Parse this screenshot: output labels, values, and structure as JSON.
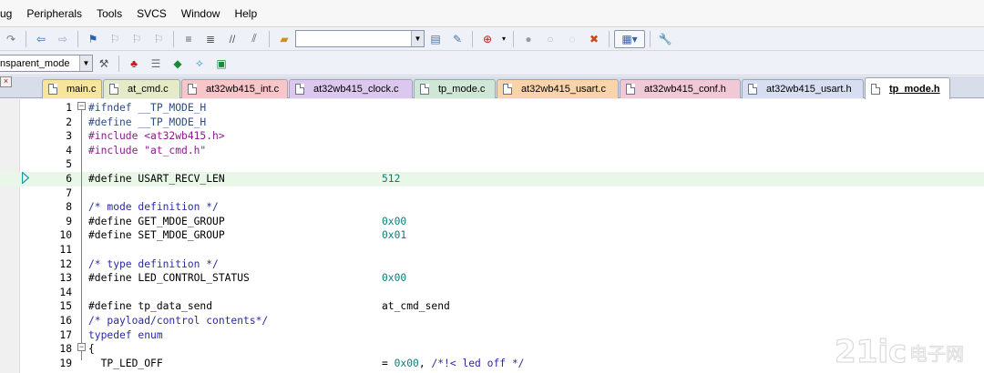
{
  "menu": [
    "ug",
    "Peripherals",
    "Tools",
    "SVCS",
    "Window",
    "Help"
  ],
  "toolbar": {
    "search_value": "",
    "mode_value": "nsparent_mode"
  },
  "tabs": [
    {
      "label": "main.c",
      "color": "#f7e59c",
      "active": false
    },
    {
      "label": "at_cmd.c",
      "color": "#e6ebc7",
      "active": false
    },
    {
      "label": "at32wb415_int.c",
      "color": "#f7c6c9",
      "active": false
    },
    {
      "label": "at32wb415_clock.c",
      "color": "#dcc8ef",
      "active": false
    },
    {
      "label": "tp_mode.c",
      "color": "#cfe7d6",
      "active": false
    },
    {
      "label": "at32wb415_usart.c",
      "color": "#f9d4aa",
      "active": false
    },
    {
      "label": "at32wb415_conf.h",
      "color": "#f1c8d6",
      "active": false
    },
    {
      "label": "at32wb415_usart.h",
      "color": "#d7def1",
      "active": false
    },
    {
      "label": "tp_mode.h",
      "color": "#ffffff",
      "active": true
    }
  ],
  "code": [
    {
      "n": "1",
      "code": [
        {
          "t": "#ifndef __TP_MODE_H",
          "c": "pp"
        }
      ]
    },
    {
      "n": "2",
      "code": [
        {
          "t": "#define __TP_MODE_H",
          "c": "pp"
        }
      ]
    },
    {
      "n": "3",
      "code": [
        {
          "t": "#include ",
          "c": "str"
        },
        {
          "t": "<at32wb415.h>",
          "c": "str"
        }
      ]
    },
    {
      "n": "4",
      "code": [
        {
          "t": "#include ",
          "c": "str"
        },
        {
          "t": "\"at_cmd.h\"",
          "c": "str"
        }
      ]
    },
    {
      "n": "5",
      "code": []
    },
    {
      "n": "6",
      "code": [
        {
          "t": "#define USART_RECV_LEN",
          "c": "plain"
        }
      ],
      "val": {
        "t": "512",
        "c": "num-c"
      },
      "hl": true
    },
    {
      "n": "7",
      "code": []
    },
    {
      "n": "8",
      "code": [
        {
          "t": "/* mode definition */",
          "c": "cmt"
        }
      ]
    },
    {
      "n": "9",
      "code": [
        {
          "t": "#define GET_MDOE_GROUP",
          "c": "plain"
        }
      ],
      "val": {
        "t": "0x00",
        "c": "num-c"
      }
    },
    {
      "n": "10",
      "code": [
        {
          "t": "#define SET_MDOE_GROUP",
          "c": "plain"
        }
      ],
      "val": {
        "t": "0x01",
        "c": "num-c"
      }
    },
    {
      "n": "11",
      "code": []
    },
    {
      "n": "12",
      "code": [
        {
          "t": "/* type definition */",
          "c": "cmt"
        }
      ]
    },
    {
      "n": "13",
      "code": [
        {
          "t": "#define LED_CONTROL_STATUS",
          "c": "plain"
        }
      ],
      "val": {
        "t": "0x00",
        "c": "num-c"
      }
    },
    {
      "n": "14",
      "code": []
    },
    {
      "n": "15",
      "code": [
        {
          "t": "#define tp_data_send",
          "c": "plain"
        }
      ],
      "val": {
        "t": "at_cmd_send",
        "c": "plain"
      }
    },
    {
      "n": "16",
      "code": [
        {
          "t": "/* payload/control contents*/",
          "c": "cmt"
        }
      ]
    },
    {
      "n": "17",
      "code": [
        {
          "t": "typedef enum",
          "c": "kw"
        }
      ]
    },
    {
      "n": "18",
      "code": [
        {
          "t": "{",
          "c": "plain"
        }
      ]
    },
    {
      "n": "19",
      "code": [
        {
          "t": "  TP_LED_OFF",
          "c": "plain"
        }
      ],
      "val": {
        "t": "= 0x00, /*!< led off */",
        "c": "mixed"
      }
    }
  ],
  "watermark": "21ic电子网"
}
